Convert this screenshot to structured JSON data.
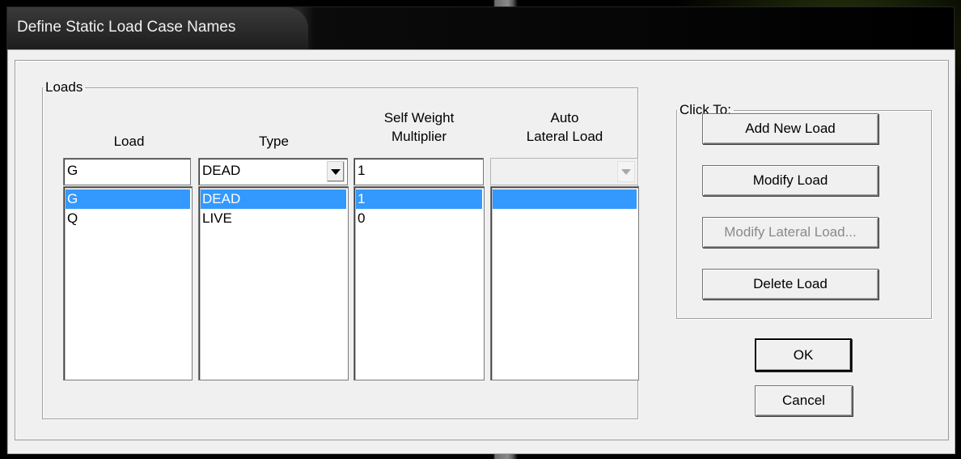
{
  "window": {
    "title": "Define Static Load Case Names"
  },
  "loads_group": {
    "legend": "Loads",
    "columns": {
      "load": "Load",
      "type": "Type",
      "self_weight": {
        "line1": "Self Weight",
        "line2": "Multiplier"
      },
      "auto_lateral": {
        "line1": "Auto",
        "line2": "Lateral Load"
      }
    },
    "inputs": {
      "load_value": "G",
      "type_value": "DEAD",
      "multiplier_value": "1",
      "auto_lateral_value": ""
    },
    "rows": [
      {
        "load": "G",
        "type": "DEAD",
        "multiplier": "1",
        "auto_lateral": "",
        "selected": true
      },
      {
        "load": "Q",
        "type": "LIVE",
        "multiplier": "0",
        "auto_lateral": "",
        "selected": false
      }
    ]
  },
  "click_to_group": {
    "legend": "Click To:",
    "add_label": "Add New Load",
    "modify_label": "Modify Load",
    "modify_lateral_label": "Modify Lateral Load...",
    "delete_label": "Delete Load"
  },
  "buttons": {
    "ok_label": "OK",
    "cancel_label": "Cancel"
  },
  "icons": {
    "dropdown": "chevron-down-icon"
  },
  "colors": {
    "selection": "#3399ff",
    "dialog_bg": "#f0f0f0"
  }
}
